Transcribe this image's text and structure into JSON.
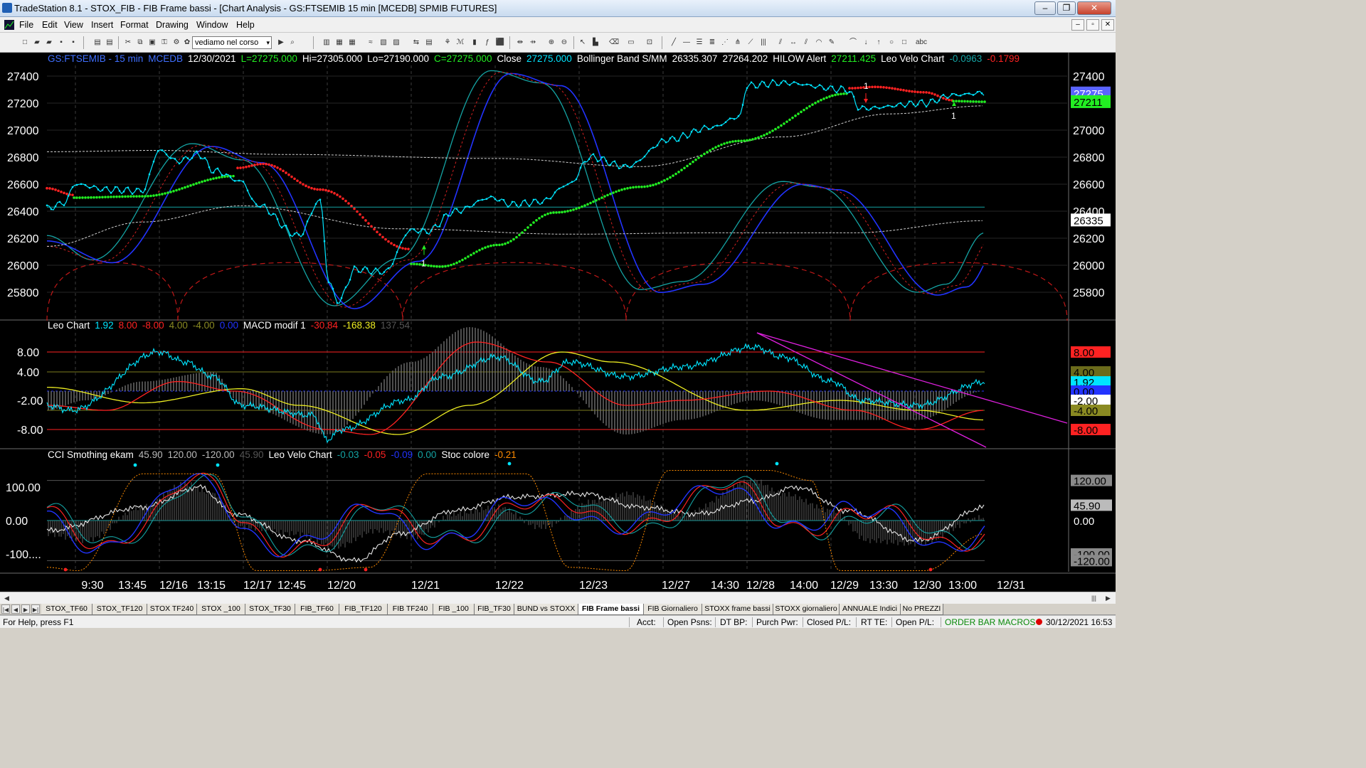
{
  "window": {
    "title": "TradeStation 8.1 - STOX_FIB - FIB Frame bassi - [Chart Analysis - GS:FTSEMIB  15 min  [MCEDB] SPMIB FUTURES]",
    "minimize": "–",
    "restore": "❐",
    "close": "✕"
  },
  "menu": [
    "File",
    "Edit",
    "View",
    "Insert",
    "Format",
    "Drawing",
    "Window",
    "Help"
  ],
  "mdi": {
    "minimize": "–",
    "restore": "▫",
    "close": "✕"
  },
  "toolbar": {
    "combo_value": "vediamo nel corso",
    "combo_arrow": "▾"
  },
  "colors": {
    "bg": "#000000",
    "cyan": "#00e5ff",
    "green": "#22ee22",
    "red": "#ff2222",
    "yellow": "#eeee22",
    "blue": "#2233ff",
    "teal": "#14a3a3",
    "magenta": "#e020e0",
    "grid": "#404040"
  },
  "panes": [
    {
      "name": "price",
      "header": [
        {
          "t": "GS:FTSEMIB - 15 min",
          "c": "#3f6fff"
        },
        {
          "t": "MCEDB",
          "c": "#3f6fff"
        },
        {
          "t": "12/30/2021",
          "c": "#ffffff"
        },
        {
          "t": "L=27275.000",
          "c": "#22ee22"
        },
        {
          "t": "Hi=27305.000",
          "c": "#ffffff"
        },
        {
          "t": "Lo=27190.000",
          "c": "#ffffff"
        },
        {
          "t": "C=27275.000",
          "c": "#22ee22"
        },
        {
          "t": "Close",
          "c": "#ffffff"
        },
        {
          "t": "27275.000",
          "c": "#00e5ff"
        },
        {
          "t": "Bollinger Band S/MM",
          "c": "#ffffff"
        },
        {
          "t": "26335.307",
          "c": "#ffffff"
        },
        {
          "t": "27264.202",
          "c": "#ffffff"
        },
        {
          "t": "HILOW Alert",
          "c": "#ffffff"
        },
        {
          "t": "27211.425",
          "c": "#22ee22"
        },
        {
          "t": "Leo Velo Chart",
          "c": "#ffffff"
        },
        {
          "t": "-0.0963",
          "c": "#14a3a3"
        },
        {
          "t": "-0.1799",
          "c": "#ff2222"
        }
      ],
      "yticks": [
        "27400",
        "27200",
        "27000",
        "26800",
        "26600",
        "26400",
        "26200",
        "26000",
        "25800"
      ],
      "badges": [
        {
          "t": "27275",
          "bg": "#5a64ff",
          "fg": "#ffffff"
        },
        {
          "t": "27211",
          "bg": "#22ee22",
          "fg": "#000000"
        },
        {
          "t": "26335",
          "bg": "#ffffff",
          "fg": "#000000"
        }
      ],
      "annotations": [
        "1",
        "1",
        "1"
      ]
    },
    {
      "name": "leo",
      "header": [
        {
          "t": "Leo Chart",
          "c": "#ffffff"
        },
        {
          "t": "1.92",
          "c": "#00e5ff"
        },
        {
          "t": "8.00",
          "c": "#ff2222"
        },
        {
          "t": "-8.00",
          "c": "#ff2222"
        },
        {
          "t": "4.00",
          "c": "#8a8a22"
        },
        {
          "t": "-4.00",
          "c": "#8a8a22"
        },
        {
          "t": "0.00",
          "c": "#2233ff"
        },
        {
          "t": "MACD modif 1",
          "c": "#ffffff"
        },
        {
          "t": "-30.84",
          "c": "#ff2222"
        },
        {
          "t": "-168.38",
          "c": "#eeee22"
        },
        {
          "t": "137.54",
          "c": "#555555"
        }
      ],
      "yticks": [
        "8.00",
        "4.00",
        "-2.00",
        "-8.00"
      ],
      "badges": [
        {
          "t": "8.00",
          "bg": "#ff2222",
          "fg": "#000000"
        },
        {
          "t": "4.00",
          "bg": "#6b6b1b",
          "fg": "#000000"
        },
        {
          "t": "1.92",
          "bg": "#00e5ff",
          "fg": "#000000"
        },
        {
          "t": "0.00",
          "bg": "#2233ff",
          "fg": "#000000"
        },
        {
          "t": "-2.00",
          "bg": "#ffffff",
          "fg": "#000000"
        },
        {
          "t": "-4.00",
          "bg": "#8a8a22",
          "fg": "#000000"
        },
        {
          "t": "-8.00",
          "bg": "#ff2222",
          "fg": "#000000"
        }
      ]
    },
    {
      "name": "cci",
      "header": [
        {
          "t": "CCI Smothing ekam",
          "c": "#ffffff"
        },
        {
          "t": "45.90",
          "c": "#bbbbbb"
        },
        {
          "t": "120.00",
          "c": "#bbbbbb"
        },
        {
          "t": "-120.00",
          "c": "#bbbbbb"
        },
        {
          "t": "45.90",
          "c": "#555555"
        },
        {
          "t": "Leo Velo Chart",
          "c": "#ffffff"
        },
        {
          "t": "-0.03",
          "c": "#14a3a3"
        },
        {
          "t": "-0.05",
          "c": "#ff2222"
        },
        {
          "t": "-0.09",
          "c": "#2233ff"
        },
        {
          "t": "0.00",
          "c": "#14a3a3"
        },
        {
          "t": "Stoc colore",
          "c": "#ffffff"
        },
        {
          "t": "-0.21",
          "c": "#ff8c00"
        }
      ],
      "yticks": [
        "100.00",
        "0.00",
        "-100...."
      ],
      "badges": [
        {
          "t": "120.00",
          "bg": "#8a8a8a",
          "fg": "#000000"
        },
        {
          "t": "45.90",
          "bg": "#bbbbbb",
          "fg": "#000000"
        },
        {
          "t": "0.00",
          "bg": "#000000",
          "fg": "#ffffff"
        },
        {
          "t": "-100.00",
          "bg": "#8a8a8a",
          "fg": "#000000"
        },
        {
          "t": "-120.00",
          "bg": "#8a8a8a",
          "fg": "#000000"
        }
      ]
    }
  ],
  "xaxis": [
    "9:30",
    "13:45",
    "12/16",
    "13:15",
    "12/17",
    "12:45",
    "12/20",
    "12/21",
    "12/22",
    "12/23",
    "12/27",
    "14:30",
    "12/28",
    "14:00",
    "12/29",
    "13:30",
    "12/30",
    "13:00",
    "12/31"
  ],
  "tabs": [
    "STOX_TF60",
    "STOX_TF120",
    "STOX TF240",
    "STOX _100",
    "STOX_TF30",
    "FIB_TF60",
    "FIB_TF120",
    "FIB TF240",
    "FIB _100",
    "FIB_TF30",
    "BUND vs STOXX",
    "FIB Frame bassi",
    "FIB Giornaliero",
    "STOXX frame bassi",
    "STOXX giornaliero",
    "ANNUALE Indici",
    "No PREZZI"
  ],
  "active_tab": "FIB Frame bassi",
  "status": {
    "help": "For Help, press F1",
    "acct": "Acct:",
    "open_psns": "Open Psns:",
    "dt_bp": "DT BP:",
    "purch_pwr": "Purch Pwr:",
    "closed_pl": "Closed P/L:",
    "rt_te": "RT TE:",
    "open_pl": "Open P/L:",
    "macros": "ORDER BAR MACROS",
    "datetime": "30/12/2021 16:53"
  }
}
